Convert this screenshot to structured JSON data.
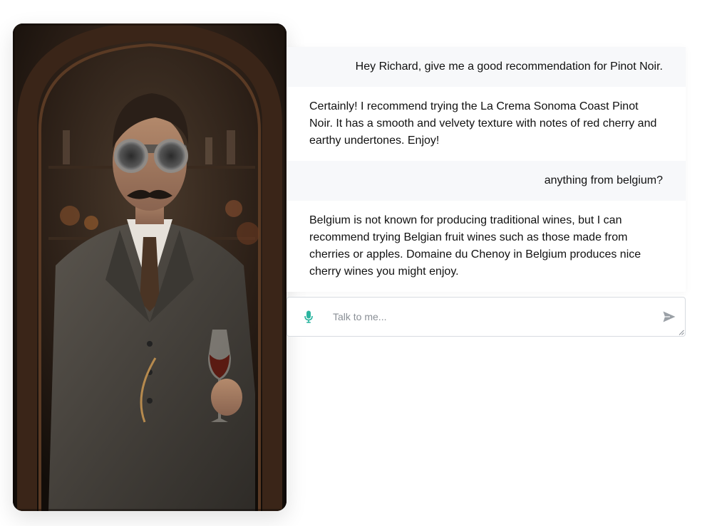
{
  "portrait": {
    "alt": "portrait-image"
  },
  "chat": {
    "messages": [
      {
        "role": "user",
        "text": "Hey Richard, give me a good recommendation for Pinot Noir."
      },
      {
        "role": "assistant",
        "text": "Certainly! I recommend trying the La Crema Sonoma Coast Pinot Noir. It has a smooth and velvety texture with notes of red cherry and earthy undertones. Enjoy!"
      },
      {
        "role": "user",
        "text": "anything from belgium?"
      },
      {
        "role": "assistant",
        "text": "Belgium is not known for producing traditional wines, but I can recommend trying Belgian fruit wines such as those made from cherries or apples. Domaine du Chenoy in Belgium produces nice cherry wines you might enjoy."
      }
    ]
  },
  "input": {
    "placeholder": "Talk to me...",
    "value": ""
  },
  "icons": {
    "mic": "microphone-icon",
    "send": "send-icon"
  },
  "colors": {
    "accent": "#2bb5a0",
    "send_icon": "#9aa0a6",
    "user_bubble": "#f7f8fa"
  }
}
